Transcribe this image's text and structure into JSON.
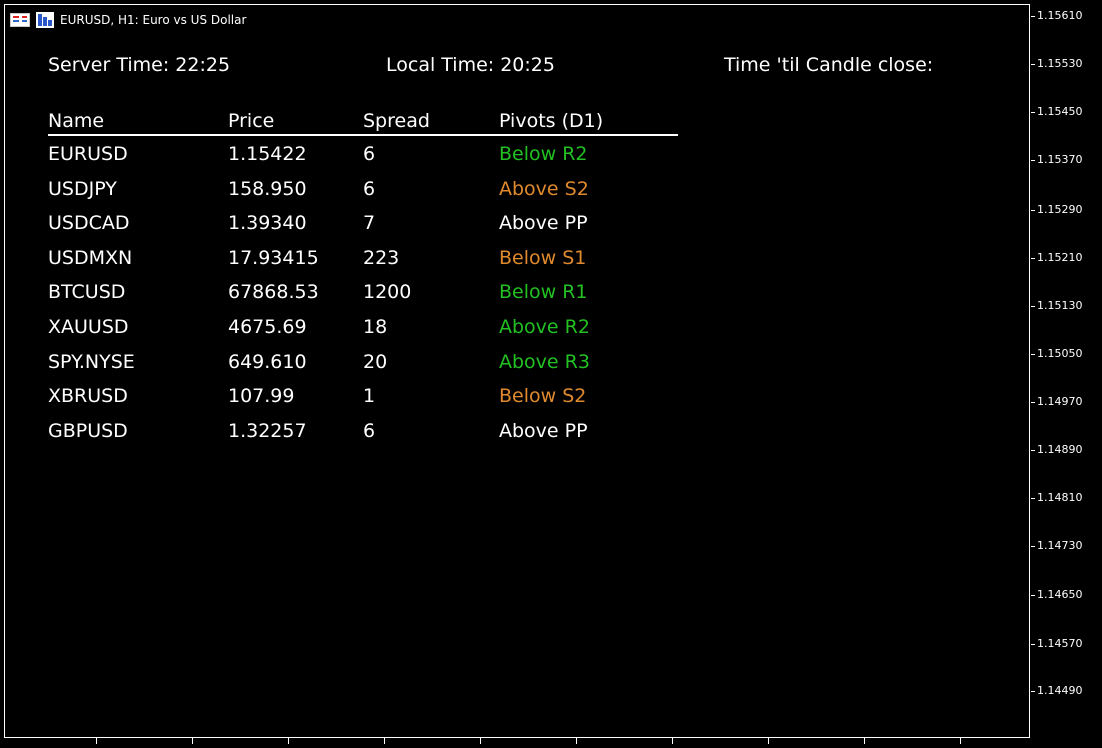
{
  "window": {
    "title": "EURUSD, H1:  Euro vs US Dollar"
  },
  "header": {
    "server_time": "Server Time: 22:25",
    "local_time": "Local Time: 20:25",
    "candle_close": "Time 'til Candle close:"
  },
  "table": {
    "columns": [
      "Name",
      "Price",
      "Spread",
      "Pivots (D1)"
    ],
    "rows": [
      {
        "name": "EURUSD",
        "price": "1.15422",
        "spread": "6",
        "pivot": "Below R2",
        "pivot_color": "#22c022"
      },
      {
        "name": "USDJPY",
        "price": "158.950",
        "spread": "6",
        "pivot": "Above S2",
        "pivot_color": "#e08a2e"
      },
      {
        "name": "USDCAD",
        "price": "1.39340",
        "spread": "7",
        "pivot": "Above PP",
        "pivot_color": "#ffffff"
      },
      {
        "name": "USDMXN",
        "price": "17.93415",
        "spread": "223",
        "pivot": "Below S1",
        "pivot_color": "#e08a2e"
      },
      {
        "name": "BTCUSD",
        "price": "67868.53",
        "spread": "1200",
        "pivot": "Below R1",
        "pivot_color": "#22c022"
      },
      {
        "name": "XAUUSD",
        "price": "4675.69",
        "spread": "18",
        "pivot": "Above R2",
        "pivot_color": "#22c022"
      },
      {
        "name": "SPY.NYSE",
        "price": "649.610",
        "spread": "20",
        "pivot": "Above R3",
        "pivot_color": "#22c022"
      },
      {
        "name": "XBRUSD",
        "price": "107.99",
        "spread": "1",
        "pivot": "Below S2",
        "pivot_color": "#e08a2e"
      },
      {
        "name": "GBPUSD",
        "price": "1.32257",
        "spread": "6",
        "pivot": "Above PP",
        "pivot_color": "#ffffff"
      }
    ]
  },
  "price_scale": {
    "labels": [
      "1.15610",
      "1.15530",
      "1.15450",
      "1.15370",
      "1.15290",
      "1.15210",
      "1.15130",
      "1.15050",
      "1.14970",
      "1.14890",
      "1.14810",
      "1.14730",
      "1.14650",
      "1.14570",
      "1.14490"
    ]
  },
  "icons": {
    "chart_list": "grid-icon",
    "chart_type": "candlestick-icon"
  }
}
